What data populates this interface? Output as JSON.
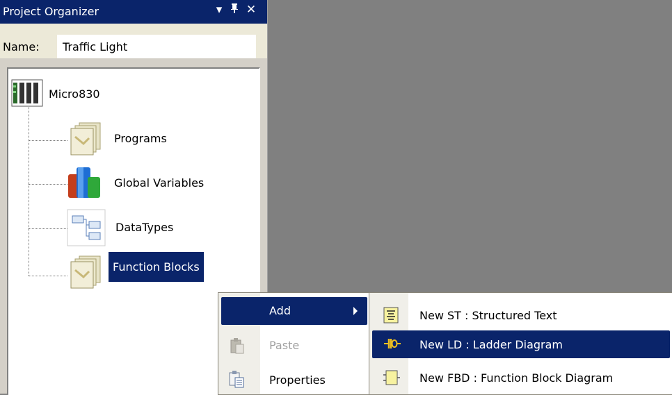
{
  "panel": {
    "title": "Project Organizer",
    "title_buttons": {
      "dropdown": "▾",
      "pin": "ᵖ",
      "close": "✕"
    },
    "name_label": "Name:",
    "name_value": "Traffic Light"
  },
  "tree": {
    "root": {
      "label": "Micro830",
      "icon": "controller-icon"
    },
    "children": [
      {
        "label": "Programs",
        "icon": "folder-stack-icon"
      },
      {
        "label": "Global Variables",
        "icon": "global-variables-icon"
      },
      {
        "label": "DataTypes",
        "icon": "datatypes-icon"
      },
      {
        "label": "Function Blocks",
        "icon": "folder-stack-icon",
        "selected": true
      }
    ]
  },
  "context_menu": {
    "items": [
      {
        "label": "Add",
        "icon": "none",
        "has_submenu": true,
        "active": true
      },
      {
        "label": "Paste",
        "icon": "paste-icon",
        "disabled": true
      },
      {
        "label": "Properties",
        "icon": "properties-icon"
      }
    ]
  },
  "submenu": {
    "items": [
      {
        "label": "New ST : Structured Text",
        "icon": "structured-text-icon"
      },
      {
        "label": "New LD : Ladder Diagram",
        "icon": "ladder-diagram-icon",
        "active": true
      },
      {
        "label": "New FBD : Function Block Diagram",
        "icon": "function-block-diagram-icon"
      }
    ]
  },
  "colors": {
    "selection": "#0a246a",
    "workspace": "#808080",
    "panel_bg": "#d4d0c8"
  }
}
